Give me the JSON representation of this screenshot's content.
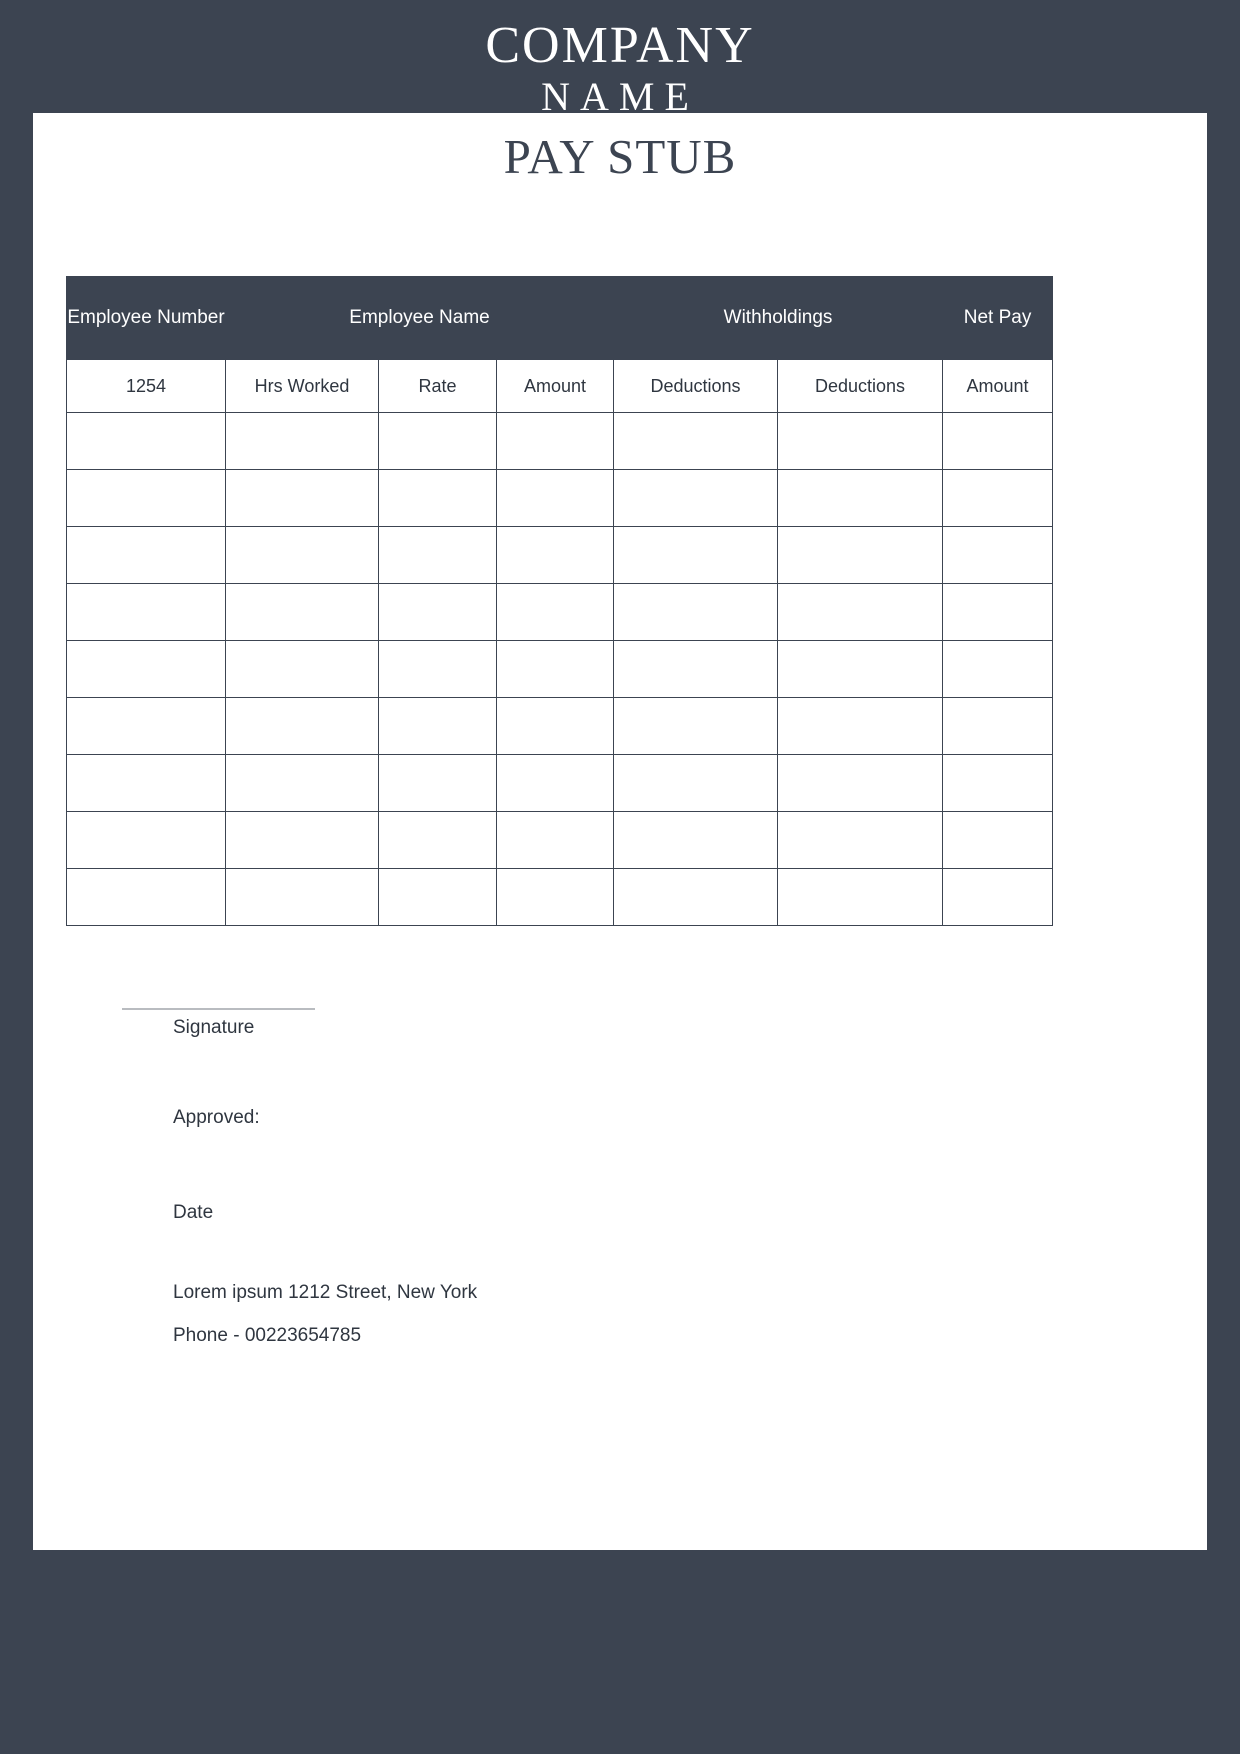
{
  "brand": {
    "name": "COMPANY",
    "subtitle": "NAME"
  },
  "document": {
    "title": "PAY STUB"
  },
  "table": {
    "header_main": [
      {
        "label": "Employee Number",
        "span": 1
      },
      {
        "label": "Employee Name",
        "span": 3
      },
      {
        "label": "Withholdings",
        "span": 2
      },
      {
        "label": "Net Pay",
        "span": 1
      }
    ],
    "header_sub": [
      "1254",
      "Hrs Worked",
      "Rate",
      "Amount",
      "Deductions",
      "Deductions",
      "Amount"
    ],
    "empty_row_count": 9,
    "empty_rows": [
      [
        "",
        "",
        "",
        "",
        "",
        "",
        ""
      ],
      [
        "",
        "",
        "",
        "",
        "",
        "",
        ""
      ],
      [
        "",
        "",
        "",
        "",
        "",
        "",
        ""
      ],
      [
        "",
        "",
        "",
        "",
        "",
        "",
        ""
      ],
      [
        "",
        "",
        "",
        "",
        "",
        "",
        ""
      ],
      [
        "",
        "",
        "",
        "",
        "",
        "",
        ""
      ],
      [
        "",
        "",
        "",
        "",
        "",
        "",
        ""
      ],
      [
        "",
        "",
        "",
        "",
        "",
        "",
        ""
      ],
      [
        "",
        "",
        "",
        "",
        "",
        "",
        ""
      ]
    ]
  },
  "footer": {
    "signature_label": "Signature",
    "approved_label": "Approved:",
    "date_label": "Date",
    "address": "Lorem ipsum 1212 Street, New York",
    "phone": "Phone - 00223654785"
  },
  "colors": {
    "page_background": "#3c4451",
    "sheet": "#ffffff",
    "header_fill": "#3c4451",
    "header_text": "#ffffff",
    "body_text": "#2f3640",
    "rule": "#b9bcc0"
  }
}
